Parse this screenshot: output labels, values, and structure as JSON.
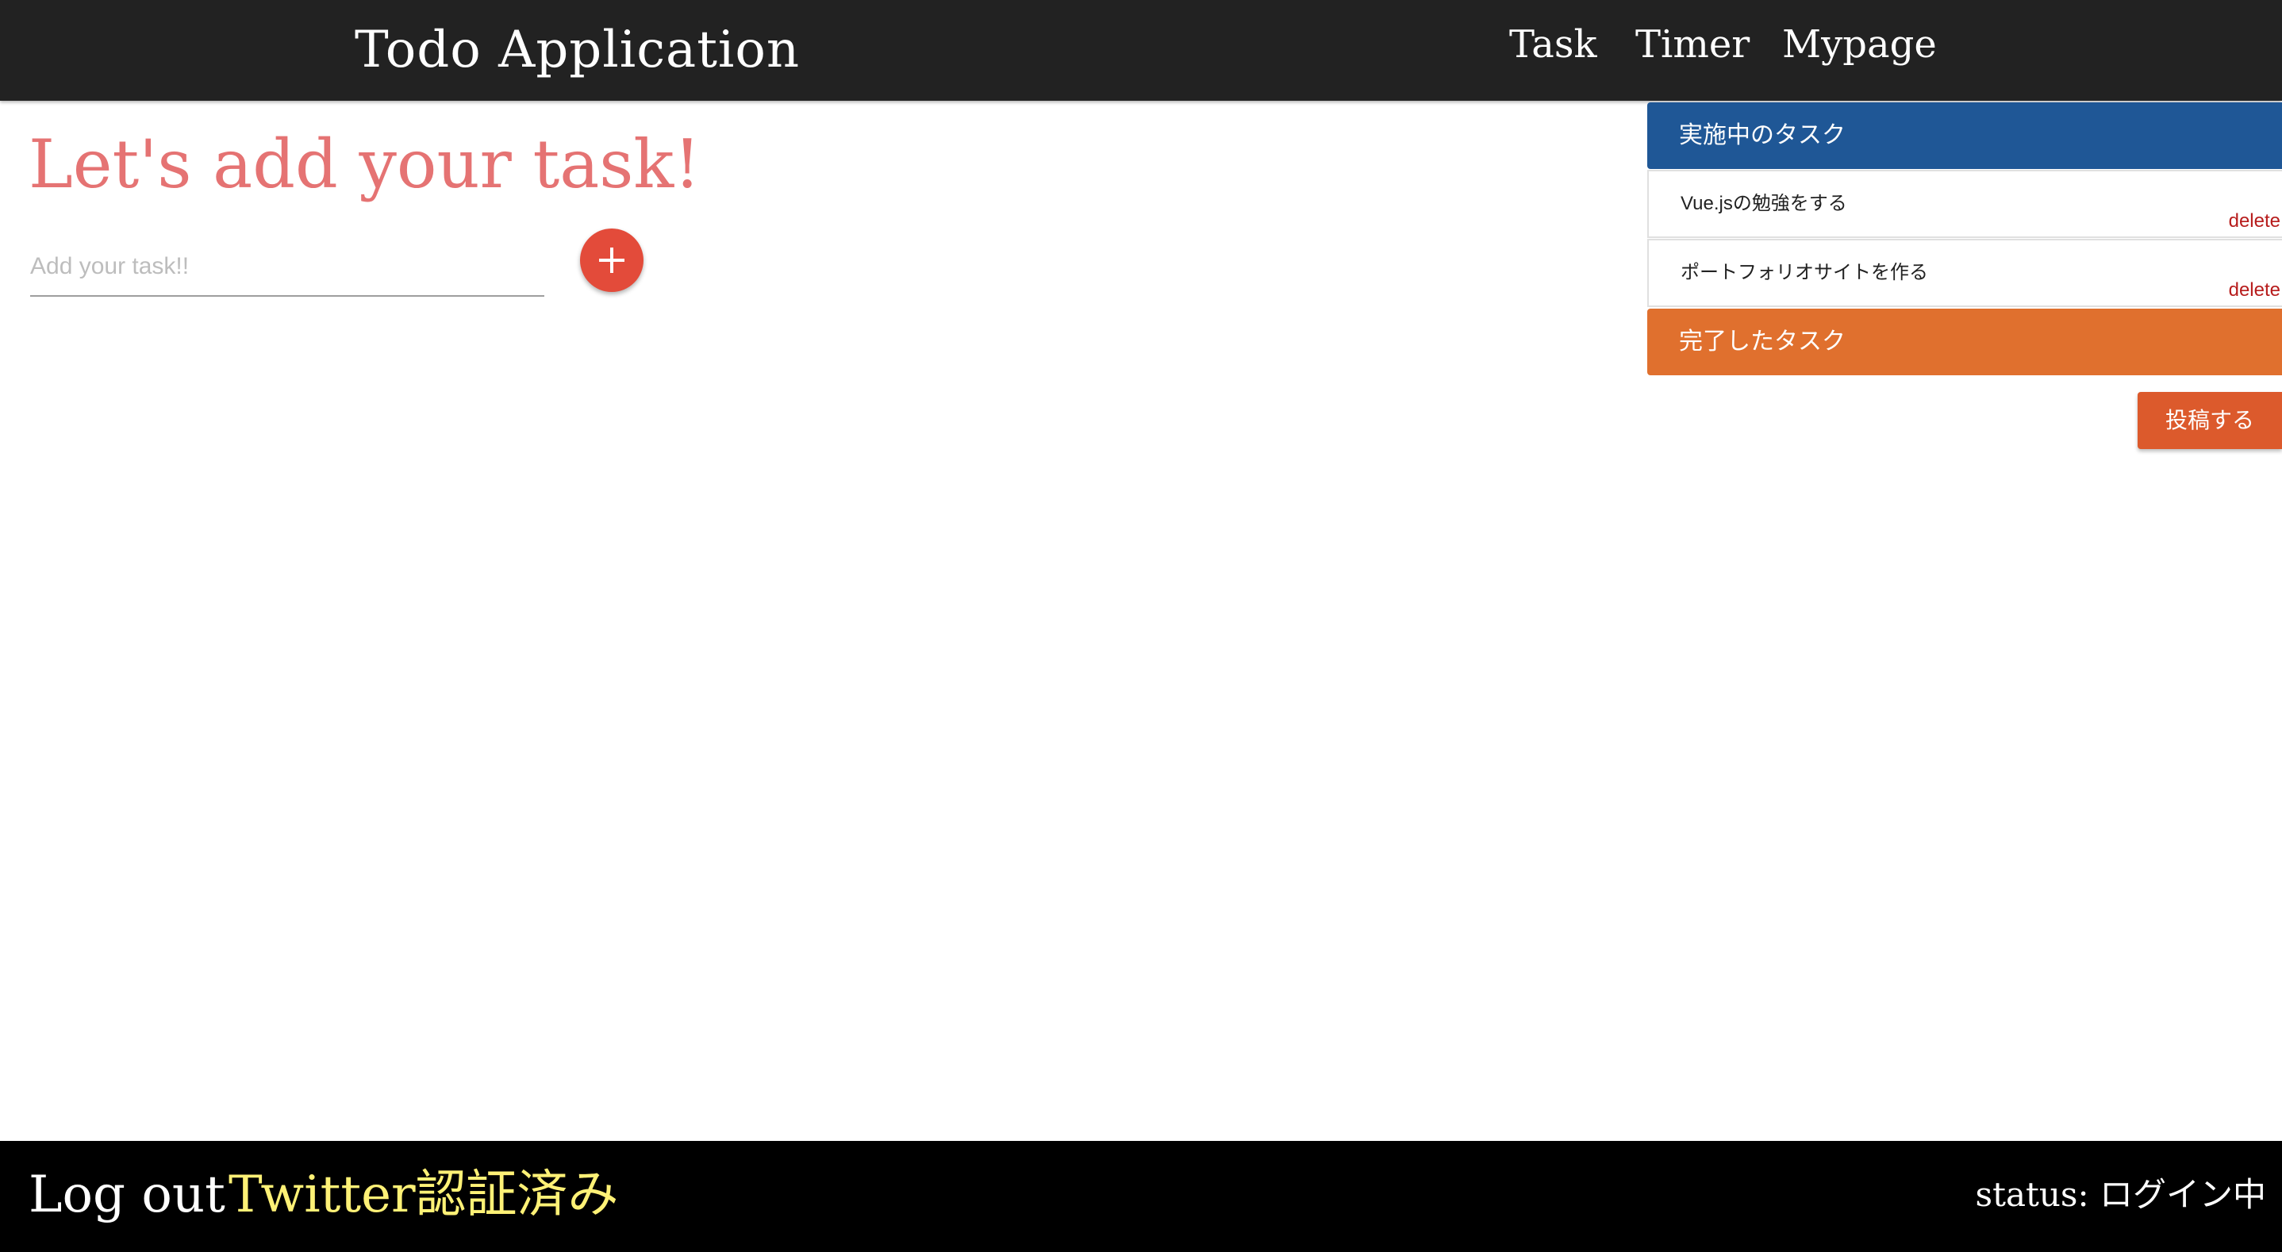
{
  "header": {
    "title": "Todo Application",
    "nav": [
      {
        "label": "Task"
      },
      {
        "label": "Timer"
      },
      {
        "label": "Mypage"
      }
    ]
  },
  "main": {
    "heading": "Let's add your task!",
    "input_placeholder": "Add your task!!",
    "input_value": "",
    "add_icon": "plus-icon"
  },
  "tasks_panel": {
    "active_header": "実施中のタスク",
    "items": [
      {
        "text": "Vue.jsの勉強をする",
        "delete_label": "delete"
      },
      {
        "text": "ポートフォリオサイトを作る",
        "delete_label": "delete"
      }
    ],
    "done_header": "完了したタスク",
    "post_label": "投稿する"
  },
  "footer": {
    "logout_label": "Log out",
    "twitter_status": "Twitter認証済み",
    "login_status": "status: ログイン中"
  },
  "colors": {
    "header_bg": "#222222",
    "heading": "#e57373",
    "add_button": "#e34b3a",
    "active_header": "#1f5796",
    "done_header": "#e0702e",
    "delete": "#b71c1c",
    "post_button": "#dc5a2c",
    "footer_bg": "#000000",
    "twitter_status": "#fff176"
  }
}
